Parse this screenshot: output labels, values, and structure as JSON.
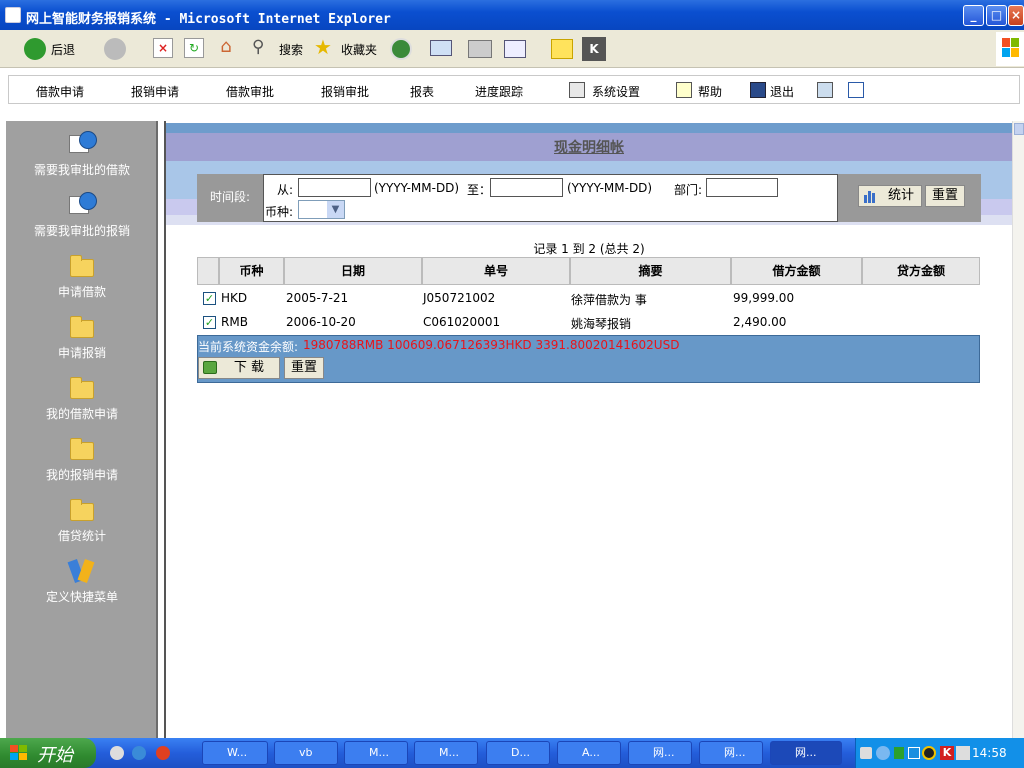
{
  "window": {
    "title": "网上智能财务报销系统 - Microsoft Internet Explorer",
    "controls": {
      "minimize": "_",
      "maximize": "□",
      "close": "×"
    }
  },
  "ie_toolbar": {
    "back": "后退",
    "search": "搜索",
    "favorites": "收藏夹"
  },
  "app_menu": {
    "items": [
      "借款申请",
      "报销申请",
      "借款审批",
      "报销审批",
      "报表",
      "进度跟踪",
      "系统设置",
      "帮助",
      "退出"
    ]
  },
  "sidebar": {
    "items": [
      {
        "label": "需要我审批的借款",
        "icon": "globe-calendar-icon"
      },
      {
        "label": "需要我审批的报销",
        "icon": "globe-calendar-icon"
      },
      {
        "label": "申请借款",
        "icon": "folder-icon"
      },
      {
        "label": "申请报销",
        "icon": "folder-icon"
      },
      {
        "label": "我的借款申请",
        "icon": "folder-icon"
      },
      {
        "label": "我的报销申请",
        "icon": "folder-icon"
      },
      {
        "label": "借贷统计",
        "icon": "folder-icon"
      },
      {
        "label": "定义快捷菜单",
        "icon": "shortcut-icon"
      }
    ]
  },
  "page": {
    "title": "现金明细帐",
    "filter": {
      "period_label": "时间段:",
      "from_label": "从:",
      "from_hint": "(YYYY-MM-DD)",
      "to_label": "至：",
      "to_hint": "(YYYY-MM-DD)",
      "dept_label": "部门:",
      "currency_label": "币种:",
      "stats_button": "统计",
      "reset_button": "重置"
    },
    "records_summary": "记录 1 到 2 (总共 2)",
    "table": {
      "headers": [
        "币种",
        "日期",
        "单号",
        "摘要",
        "借方金额",
        "贷方金额"
      ],
      "rows": [
        {
          "currency": "HKD",
          "date": "2005-7-21",
          "no": "J050721002",
          "summary": "徐萍借款为 事",
          "debit": "99,999.00",
          "credit": ""
        },
        {
          "currency": "RMB",
          "date": "2006-10-20",
          "no": "C061020001",
          "summary": "姚海琴报销",
          "debit": "2,490.00",
          "credit": ""
        }
      ]
    },
    "balance_label": "当前系统资金余额:",
    "balance_value": "1980788RMB 100609.067126393HKD 3391.80020141602USD",
    "download_button": "下 载",
    "reset_button2": "重置"
  },
  "taskbar": {
    "start": "开始",
    "tasks": [
      "W...",
      "vb",
      "M...",
      "M...",
      "D...",
      "A...",
      "网...",
      "网...",
      "网..."
    ],
    "clock": "14:58"
  },
  "colors": {
    "title_band": "#9fa0d1",
    "sidebar": "#a0a0a0",
    "balance_bar": "#6798c8",
    "balance_text": "#e8141a"
  }
}
